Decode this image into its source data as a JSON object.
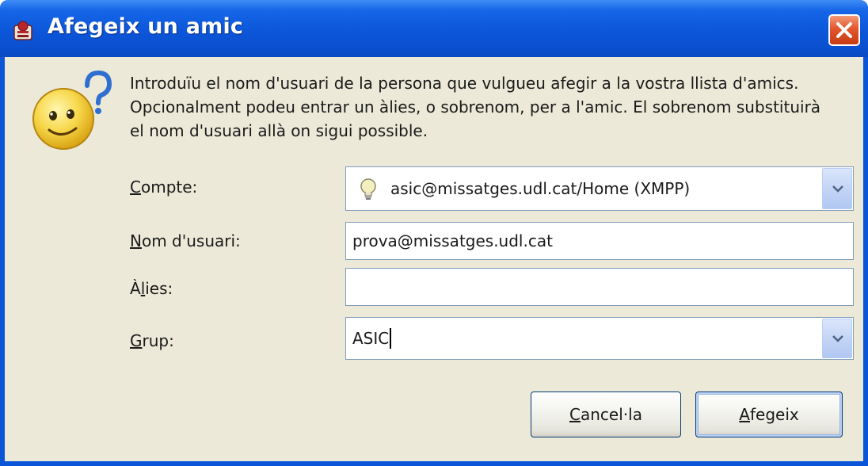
{
  "window": {
    "title": "Afegeix un amic"
  },
  "description": "Introduïu el nom d'usuari de la persona que vulgueu afegir a la vostra llista d'amics. Opcionalment podeu entrar un àlies, o sobrenom, per a l'amic. El sobrenom substituirà el nom d'usuari allà on sigui possible.",
  "fields": {
    "account": {
      "label_mnemonic": "C",
      "label_rest": "ompte:",
      "value": "asic@missatges.udl.cat/Home (XMPP)",
      "icon": "lightbulb-icon"
    },
    "username": {
      "label_mnemonic": "N",
      "label_rest": "om d'usuari:",
      "value": "prova@missatges.udl.cat"
    },
    "alias": {
      "label_first": "À",
      "label_mnemonic": "l",
      "label_rest": "ies:",
      "value": ""
    },
    "group": {
      "label_mnemonic": "G",
      "label_rest": "rup:",
      "value": "ASIC"
    }
  },
  "buttons": {
    "cancel": {
      "mnemonic": "C",
      "rest": "ancel·la"
    },
    "add": {
      "mnemonic": "A",
      "rest": "fegeix"
    }
  },
  "colors": {
    "titlebar": "#0a55d8",
    "client": "#ece9d8",
    "close": "#e2562c"
  }
}
